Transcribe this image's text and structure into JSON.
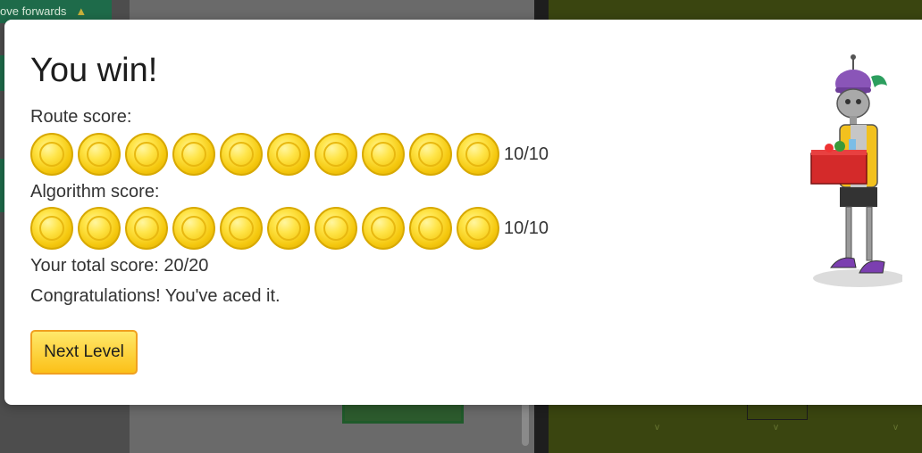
{
  "background": {
    "block_label": "ove forwards"
  },
  "dialog": {
    "title": "You win!",
    "route_label": "Route score:",
    "route_score": "10/10",
    "route_coins": 10,
    "algorithm_label": "Algorithm score:",
    "algorithm_score": "10/10",
    "algorithm_coins": 10,
    "total": "Your total score: 20/20",
    "message": "Congratulations! You've aced it.",
    "next_button": "Next Level"
  },
  "colors": {
    "coin": "#f5c80f",
    "button": "#fbc018",
    "robot_hat": "#8a55b8"
  },
  "icons": {
    "coin": "gold-coin-icon",
    "robot": "robot-mascot-icon"
  }
}
